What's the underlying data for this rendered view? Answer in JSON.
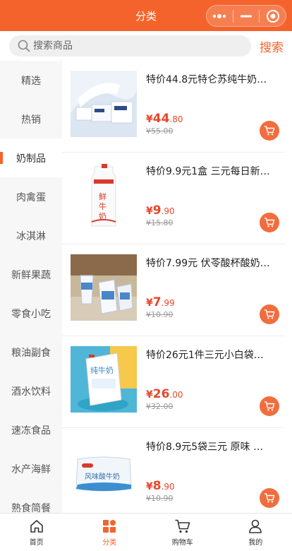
{
  "header": {
    "title": "分类"
  },
  "search": {
    "placeholder": "搜索商品",
    "button_label": "搜索"
  },
  "sidebar": {
    "items": [
      {
        "label": "精选"
      },
      {
        "label": "热销"
      },
      {
        "label": "奶制品"
      },
      {
        "label": "肉禽蛋"
      },
      {
        "label": "冰淇淋"
      },
      {
        "label": "新鲜果蔬"
      },
      {
        "label": "零食小吃"
      },
      {
        "label": "粮油副食"
      },
      {
        "label": "酒水饮料"
      },
      {
        "label": "速冻食品"
      },
      {
        "label": "水产海鲜"
      },
      {
        "label": "熟食简餐"
      }
    ],
    "active_index": 2
  },
  "products": [
    {
      "title": "特价44.8元特仑苏纯牛奶…",
      "currency": "¥",
      "price_int": "44",
      "price_dec": ".80",
      "old_price": "¥55.00"
    },
    {
      "title": "特价9.9元1盒 三元每日新…",
      "currency": "¥",
      "price_int": "9",
      "price_dec": ".90",
      "old_price": "¥15.80"
    },
    {
      "title": "特价7.99元 伏苓酸杯酸奶…",
      "currency": "¥",
      "price_int": "7",
      "price_dec": ".99",
      "old_price": "¥10.90"
    },
    {
      "title": "特价26元1件三元小白袋…",
      "currency": "¥",
      "price_int": "26",
      "price_dec": ".00",
      "old_price": "¥32.00"
    },
    {
      "title": "特价8.9元5袋三元 原味 …",
      "currency": "¥",
      "price_int": "8",
      "price_dec": ".90",
      "old_price": "¥10.90"
    }
  ],
  "tabbar": {
    "items": [
      {
        "label": "首页",
        "icon": "home-icon"
      },
      {
        "label": "分类",
        "icon": "category-icon"
      },
      {
        "label": "购物车",
        "icon": "cart-icon"
      },
      {
        "label": "我的",
        "icon": "user-icon"
      }
    ],
    "active_index": 1
  },
  "colors": {
    "accent": "#f5632c",
    "price": "#e8462b",
    "sidebar_bg": "#f7f7f7"
  }
}
